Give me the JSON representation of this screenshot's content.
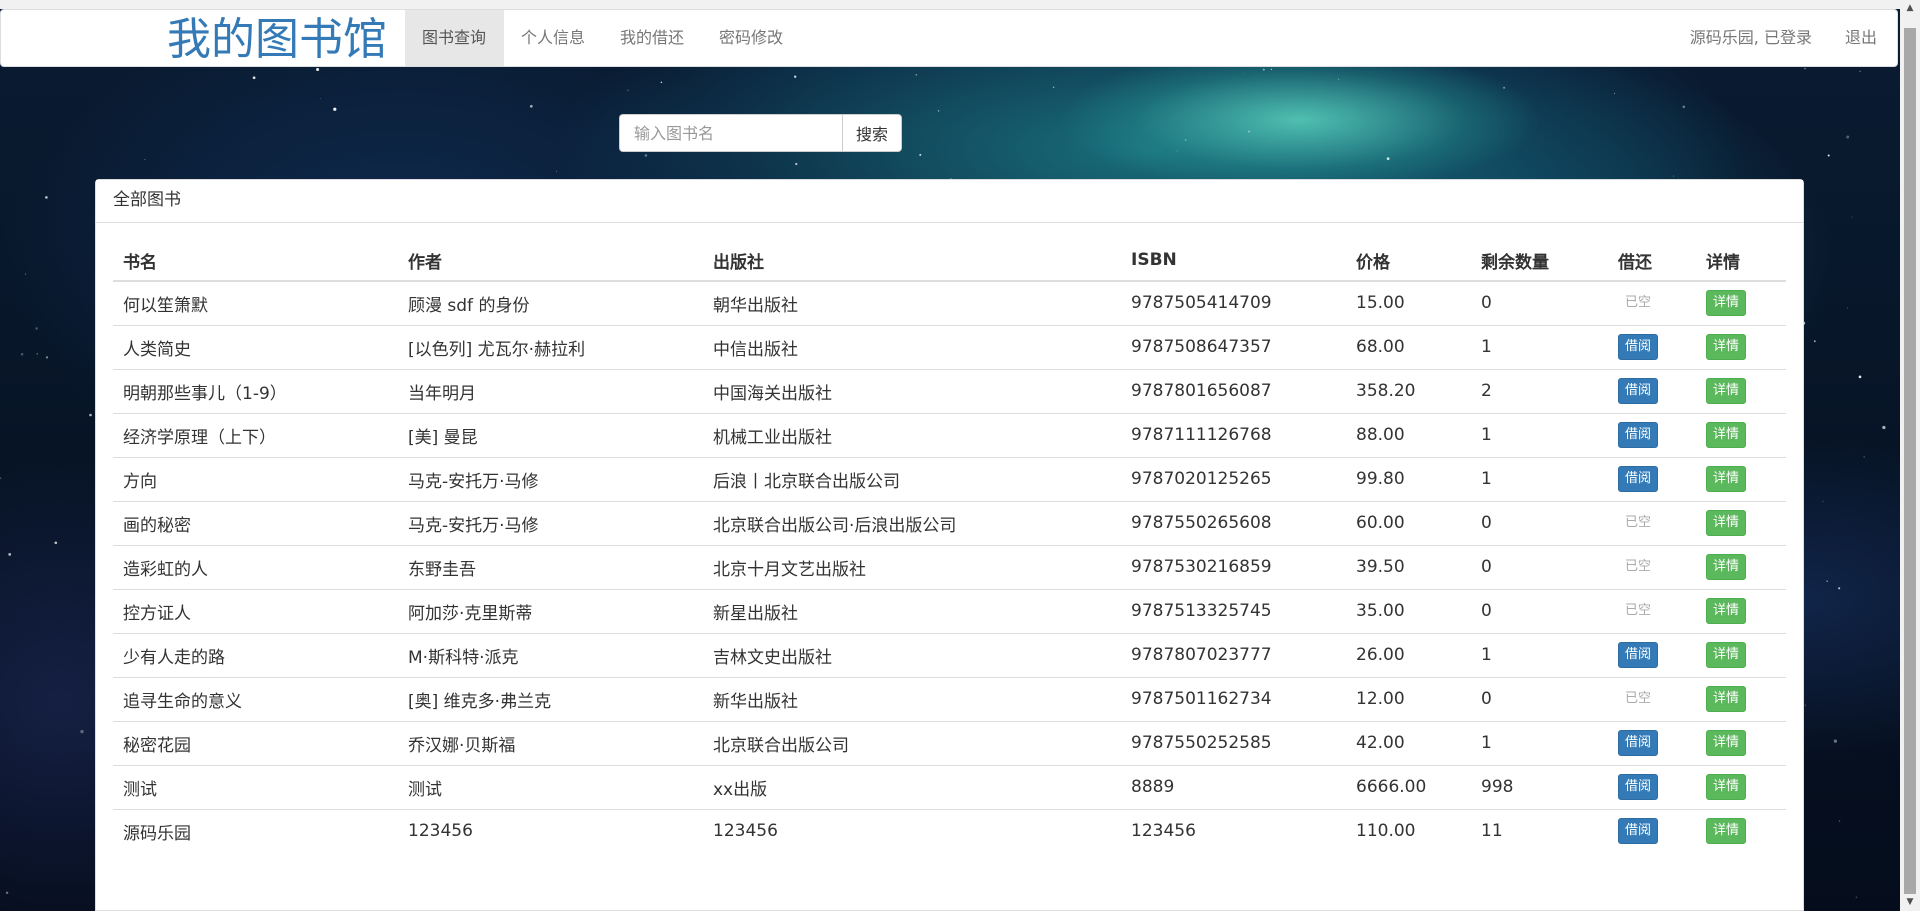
{
  "brand": "我的图书馆",
  "nav": {
    "items": [
      {
        "label": "图书查询",
        "active": true
      },
      {
        "label": "个人信息",
        "active": false
      },
      {
        "label": "我的借还",
        "active": false
      },
      {
        "label": "密码修改",
        "active": false
      }
    ],
    "user_status": "源码乐园, 已登录",
    "logout": "退出"
  },
  "search": {
    "placeholder": "输入图书名",
    "value": "",
    "button": "搜索"
  },
  "panel": {
    "title": "全部图书"
  },
  "table": {
    "headers": [
      "书名",
      "作者",
      "出版社",
      "ISBN",
      "价格",
      "剩余数量",
      "借还",
      "详情"
    ],
    "rows": [
      {
        "name": "何以笙箫默",
        "author": "顾漫 sdf 的身份",
        "publisher": "朝华出版社",
        "isbn": "9787505414709",
        "price": "15.00",
        "remaining": "0",
        "borrow": "已空",
        "available": false,
        "detail": "详情"
      },
      {
        "name": "人类简史",
        "author": "[以色列] 尤瓦尔·赫拉利",
        "publisher": "中信出版社",
        "isbn": "9787508647357",
        "price": "68.00",
        "remaining": "1",
        "borrow": "借阅",
        "available": true,
        "detail": "详情"
      },
      {
        "name": "明朝那些事儿（1-9）",
        "author": "当年明月",
        "publisher": "中国海关出版社",
        "isbn": "9787801656087",
        "price": "358.20",
        "remaining": "2",
        "borrow": "借阅",
        "available": true,
        "detail": "详情"
      },
      {
        "name": "经济学原理（上下）",
        "author": "[美] 曼昆",
        "publisher": "机械工业出版社",
        "isbn": "9787111126768",
        "price": "88.00",
        "remaining": "1",
        "borrow": "借阅",
        "available": true,
        "detail": "详情"
      },
      {
        "name": "方向",
        "author": "马克-安托万·马修",
        "publisher": "后浪丨北京联合出版公司",
        "isbn": "9787020125265",
        "price": "99.80",
        "remaining": "1",
        "borrow": "借阅",
        "available": true,
        "detail": "详情"
      },
      {
        "name": "画的秘密",
        "author": "马克-安托万·马修",
        "publisher": "北京联合出版公司·后浪出版公司",
        "isbn": "9787550265608",
        "price": "60.00",
        "remaining": "0",
        "borrow": "已空",
        "available": false,
        "detail": "详情"
      },
      {
        "name": "造彩虹的人",
        "author": "东野圭吾",
        "publisher": "北京十月文艺出版社",
        "isbn": "9787530216859",
        "price": "39.50",
        "remaining": "0",
        "borrow": "已空",
        "available": false,
        "detail": "详情"
      },
      {
        "name": "控方证人",
        "author": "阿加莎·克里斯蒂",
        "publisher": "新星出版社",
        "isbn": "9787513325745",
        "price": "35.00",
        "remaining": "0",
        "borrow": "已空",
        "available": false,
        "detail": "详情"
      },
      {
        "name": "少有人走的路",
        "author": "M·斯科特·派克",
        "publisher": "吉林文史出版社",
        "isbn": "9787807023777",
        "price": "26.00",
        "remaining": "1",
        "borrow": "借阅",
        "available": true,
        "detail": "详情"
      },
      {
        "name": "追寻生命的意义",
        "author": "[奥] 维克多·弗兰克",
        "publisher": "新华出版社",
        "isbn": "9787501162734",
        "price": "12.00",
        "remaining": "0",
        "borrow": "已空",
        "available": false,
        "detail": "详情"
      },
      {
        "name": "秘密花园",
        "author": "乔汉娜·贝斯福",
        "publisher": "北京联合出版公司",
        "isbn": "9787550252585",
        "price": "42.00",
        "remaining": "1",
        "borrow": "借阅",
        "available": true,
        "detail": "详情"
      },
      {
        "name": "测试",
        "author": "测试",
        "publisher": "xx出版",
        "isbn": "8889",
        "price": "6666.00",
        "remaining": "998",
        "borrow": "借阅",
        "available": true,
        "detail": "详情"
      },
      {
        "name": "源码乐园",
        "author": "123456",
        "publisher": "123456",
        "isbn": "123456",
        "price": "110.00",
        "remaining": "11",
        "borrow": "借阅",
        "available": true,
        "detail": "详情"
      }
    ]
  },
  "colors": {
    "brand": "#337ab7",
    "borrow_button": "#337ab7",
    "detail_button": "#5cb85c",
    "empty_text": "#aaaaaa"
  }
}
